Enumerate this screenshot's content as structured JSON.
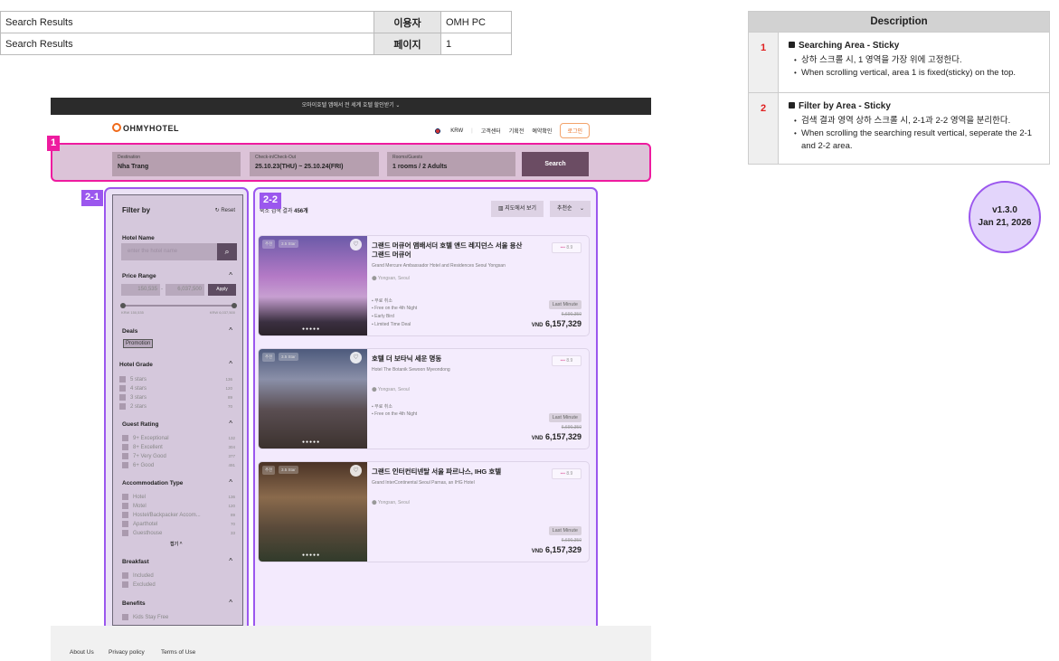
{
  "meta": {
    "rows": [
      {
        "title": "Search Results",
        "key": "이용자",
        "value": "OMH PC"
      },
      {
        "title": "Search Results",
        "key": "페이지",
        "value": "1"
      }
    ]
  },
  "description": {
    "header": "Description",
    "items": [
      {
        "num": "1",
        "title": "Searching Area - Sticky",
        "bullets": [
          "상하 스크롤 시, 1 영역을 가장 위에 고정한다.",
          "When scrolling vertical, area 1 is fixed(sticky) on the top."
        ]
      },
      {
        "num": "2",
        "title": "Filter by Area - Sticky",
        "bullets": [
          "검색 결과 영역 상하 스크롤 시, 2-1과 2-2 영역을 분리한다.",
          "When scrolling the searching result vertical, seperate the 2-1 and 2-2 area."
        ]
      }
    ]
  },
  "version": {
    "label": "v1.3.0",
    "date": "Jan 21, 2026"
  },
  "topbar": "오마이호텔 앱에서 전 세계 호텔 할인받기 ⌄",
  "header": {
    "logo": "OHMYHOTEL",
    "currency": "KRW",
    "nav": [
      "고객센터",
      "기획전",
      "예약확인"
    ],
    "login": "로그인"
  },
  "search": {
    "fields": [
      {
        "label": "Destination",
        "value": "Nha Trang"
      },
      {
        "label": "Check-in/Check-Out",
        "value": "25.10.23(THU) ~ 25.10.24(FRI)"
      },
      {
        "label": "Rooms/Guests",
        "value": "1 rooms / 2 Adults"
      }
    ],
    "button": "Search"
  },
  "tags": {
    "a1": "1",
    "a21": "2-1",
    "a22": "2-2"
  },
  "filter": {
    "title": "Filter by",
    "reset": "Reset",
    "hotel_name_label": "Hotel Name",
    "hotel_name_placeholder": "enter the hotel name",
    "price": {
      "label": "Price Range",
      "min": "150,535",
      "max": "6,037,500",
      "apply": "Apply",
      "min_label": "KRW 150,535",
      "max_label": "KRW 6,037,500"
    },
    "deals": {
      "label": "Deals",
      "chip": "Promotion"
    },
    "grade": {
      "label": "Hotel Grade",
      "items": [
        {
          "l": "5 stars",
          "c": "136"
        },
        {
          "l": "4 stars",
          "c": "120"
        },
        {
          "l": "3 stars",
          "c": "89"
        },
        {
          "l": "2 stars",
          "c": "70"
        }
      ]
    },
    "rating": {
      "label": "Guest Rating",
      "items": [
        {
          "l": "9+ Exceptional",
          "c": "132"
        },
        {
          "l": "8+ Excellent",
          "c": "304"
        },
        {
          "l": "7+ Very Good",
          "c": "377"
        },
        {
          "l": "6+ Good",
          "c": "491"
        }
      ]
    },
    "accom": {
      "label": "Accommodation Type",
      "items": [
        {
          "l": "Hotel",
          "c": "136"
        },
        {
          "l": "Motel",
          "c": "120"
        },
        {
          "l": "Hostel/Backpacker Accom...",
          "c": "89"
        },
        {
          "l": "Aparthotel",
          "c": "70"
        },
        {
          "l": "Guesthouse",
          "c": "33"
        }
      ],
      "collapse": "접기 ^"
    },
    "breakfast": {
      "label": "Breakfast",
      "items": [
        {
          "l": "Included"
        },
        {
          "l": "Excluded"
        }
      ]
    },
    "benefits": {
      "label": "Benefits",
      "items": [
        {
          "l": "Kids Stay Free"
        }
      ]
    }
  },
  "results": {
    "count_prefix": "숙소 검색 결과 ",
    "count": "456개",
    "map_btn": "지도에서 보기",
    "sort": "추천순",
    "hotels": [
      {
        "badge1": "추천",
        "badge2": "3.5 Star",
        "title": "그랜드 머큐어 앰배서더 호텔 앤드 레지던스 서울 용산 그랜드 머큐어",
        "sub": "Grand Mercure Ambassador Hotel and Residences Seoul Yongsan",
        "loc": "Yongsan, Seoul",
        "score": "8.9",
        "perks": [
          "무료 취소",
          "Free on the 4th Night",
          "Early Bird",
          "Limited Time Deal"
        ],
        "tag": "Last Minute",
        "old": "6,690,350",
        "currency": "VND",
        "price": "6,157,329"
      },
      {
        "badge1": "추천",
        "badge2": "3.5 Star",
        "title": "호텔 더 보타닉 세운 명동",
        "sub": "Hotel The Botanik Sewoon Myeondong",
        "loc": "Yongsan, Seoul",
        "score": "8.9",
        "perks": [
          "무료 취소",
          "Free on the 4th Night"
        ],
        "tag": "Last Minute",
        "old": "6,690,350",
        "currency": "VND",
        "price": "6,157,329"
      },
      {
        "badge1": "추천",
        "badge2": "3.5 Star",
        "title": "그랜드 인터컨티넨탈 서울 파르나스, IHG 호텔",
        "sub": "Grand InterContinental Seoul Parnas, an IHG Hotel",
        "loc": "Yongsan, Seoul",
        "score": "8.9",
        "perks": [],
        "tag": "Last Minute",
        "old": "6,690,350",
        "currency": "VND",
        "price": "6,157,329"
      }
    ]
  },
  "footer": {
    "links": [
      "About Us",
      "Privacy policy",
      "Terms of Use"
    ]
  }
}
